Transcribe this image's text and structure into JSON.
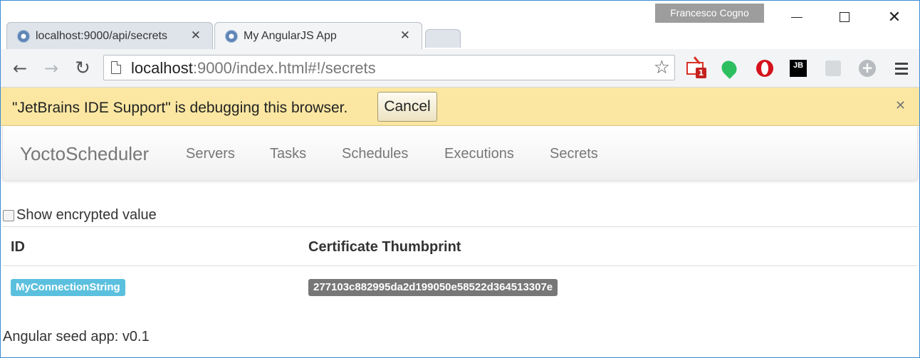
{
  "window": {
    "user": "Francesco Cogno",
    "controls": {
      "minimize": "minimize",
      "maximize": "maximize",
      "close": "✕"
    }
  },
  "tabs": [
    {
      "title": "localhost:9000/api/secrets",
      "close": "✕",
      "active": false
    },
    {
      "title": "My AngularJS App",
      "close": "✕",
      "active": true
    }
  ],
  "toolbar": {
    "back": "←",
    "forward": "→",
    "reload": "↻",
    "url_host": "localhost",
    "url_rest": ":9000/index.html#!/secrets",
    "bookmark_star": "☆",
    "extensions": [
      "gmail-icon",
      "evernote-icon",
      "opera-icon",
      "jetbrains-icon",
      "extension-icon",
      "extension-plus-icon"
    ],
    "gmail_count": "1",
    "jetbrains_label": "JB",
    "menu": "menu-icon"
  },
  "infobar": {
    "message": "\"JetBrains IDE Support\" is debugging this browser.",
    "cancel_label": "Cancel",
    "close": "✕"
  },
  "navbar": {
    "brand": "YoctoScheduler",
    "items": [
      "Servers",
      "Tasks",
      "Schedules",
      "Executions",
      "Secrets"
    ]
  },
  "main": {
    "checkbox_label": "Show encrypted value",
    "checkbox_checked": false,
    "table": {
      "headers": [
        "ID",
        "Certificate Thumbprint"
      ],
      "rows": [
        {
          "id": "MyConnectionString",
          "thumbprint": "277103c882995da2d199050e58522d364513307e"
        }
      ]
    },
    "footer": "Angular seed app: v0.1"
  },
  "colors": {
    "infobar_bg": "#fbe7a2",
    "label_info": "#5bc0de",
    "label_default": "#777777",
    "window_border": "#3c8bd6"
  }
}
